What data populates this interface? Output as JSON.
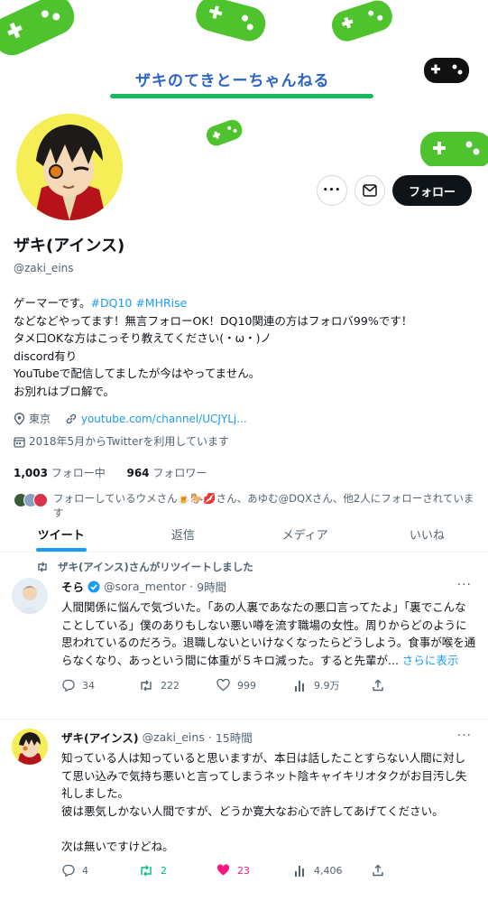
{
  "banner": {
    "title": "ザキのてきとーちゃんねる"
  },
  "profile_actions": {
    "follow_label": "フォロー",
    "more_glyph": "•••"
  },
  "profile": {
    "display_name": "ザキ(アインス)",
    "handle": "@zaki_eins",
    "bio": {
      "line1_prefix": "ゲーマーです。",
      "line1_tags": "#DQ10 #MHRise",
      "line2": "などなどやってます！無言フォローOK！DQ10関連の方はフォロバ99%です！",
      "line3": "タメ口OKな方はこっそり教えてください(・ω・)ノ",
      "line4": "discord有り",
      "line5": "YouTubeで配信してましたが今はやってません。",
      "line6": "お別れはブロ解で。"
    },
    "location": "東京",
    "website": "youtube.com/channel/UCJYLj...",
    "joined": "2018年5月からTwitterを利用しています",
    "following_count": "1,003",
    "following_label": "フォロー中",
    "followers_count": "964",
    "followers_label": "フォロワー",
    "followed_by": "フォローしているウメさん🍺🐎💋さん、あゆむ@DQXさん、他2人にフォローされています"
  },
  "tabs": [
    {
      "label": "ツイート",
      "active": true
    },
    {
      "label": "返信",
      "active": false
    },
    {
      "label": "メディア",
      "active": false
    },
    {
      "label": "いいね",
      "active": false
    }
  ],
  "tweets": [
    {
      "retweet_notice": "ザキ(アインス)さんがリツイートしました",
      "name": "そら",
      "handle": "@sora_mentor",
      "time": "9時間",
      "text": "人間関係に悩んで気づいた。「あの人裏であなたの悪口言ってたよ」「裏でこんなことしている」僕のありもしない悪い噂を流す職場の女性。周りからどのように思われているのだろう。退職しないといけなくなったらどうしよう。食事が喉を通らなくなり、あっという間に体重が５キロ減った。すると先輩が...",
      "show_more": "さらに表示",
      "replies": "34",
      "retweets": "222",
      "likes": "999",
      "views": "9.9万"
    },
    {
      "name": "ザキ(アインス)",
      "handle": "@zaki_eins",
      "time": "15時間",
      "text": "知っている人は知っていると思いますが、本日は話したことすらない人間に対して思い込みで気持ち悪いと言ってしまうネット陰キャイキリオタクがお目汚し失礼しました。\n彼は悪気しかない人間ですが、どうか寛大なお心で許してあげてください。\n\n次は無いですけどね。",
      "replies": "4",
      "retweets": "2",
      "likes": "23",
      "views": "4,406"
    }
  ],
  "colors": {
    "accent": "#1d9bf0",
    "retweet": "#00ba7c",
    "like": "#f91880",
    "text": "#0f1419",
    "muted": "#536471"
  }
}
